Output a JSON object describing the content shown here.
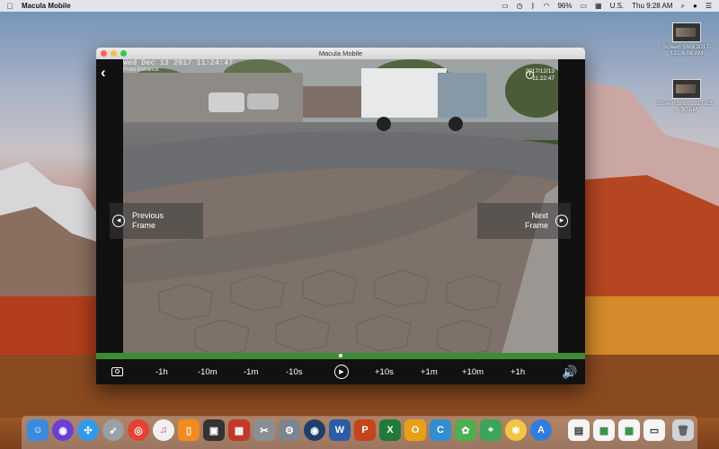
{
  "menubar": {
    "app_name": "Macula Mobile",
    "battery": "96%",
    "input_source": "U.S.",
    "clock": "Thu 9:28 AM"
  },
  "desktop": {
    "icons": [
      {
        "label": "Screen Shot 2017-12...6.08 AM"
      },
      {
        "label": "Screen Shot 2017-12... 6.30 AM"
      }
    ]
  },
  "window": {
    "title": "Macula Mobile",
    "camera": {
      "overlay_date": "Wed Dec 13 2017 11:24:47",
      "location": "Front Entrance",
      "stamp_date": "2017/12/13",
      "stamp_time": "11:22:47"
    },
    "prev_label_1": "Previous",
    "prev_label_2": "Frame",
    "next_label_1": "Next",
    "next_label_2": "Frame",
    "progress": 0.5,
    "controls": [
      "-1h",
      "-10m",
      "-1m",
      "-10s",
      "+10s",
      "+1m",
      "+10m",
      "+1h"
    ]
  },
  "dock": {
    "items": [
      "finder-icon",
      "siri-icon",
      "safari-icon",
      "launchpad-icon",
      "chrome-icon",
      "itunes-icon",
      "ibooks-icon",
      "photo-booth-icon",
      "photo-icon",
      "preview-icon",
      "system-preferences-icon",
      "macula-icon",
      "word-icon",
      "powerpoint-icon",
      "excel-icon",
      "onenote-icon",
      "camera-icon",
      "messages-icon",
      "maps-icon",
      "photos-icon",
      "app-store-icon",
      "document-icon",
      "spreadsheet-icon",
      "spreadsheet-icon-2",
      "window-icon",
      "trash-icon"
    ]
  }
}
